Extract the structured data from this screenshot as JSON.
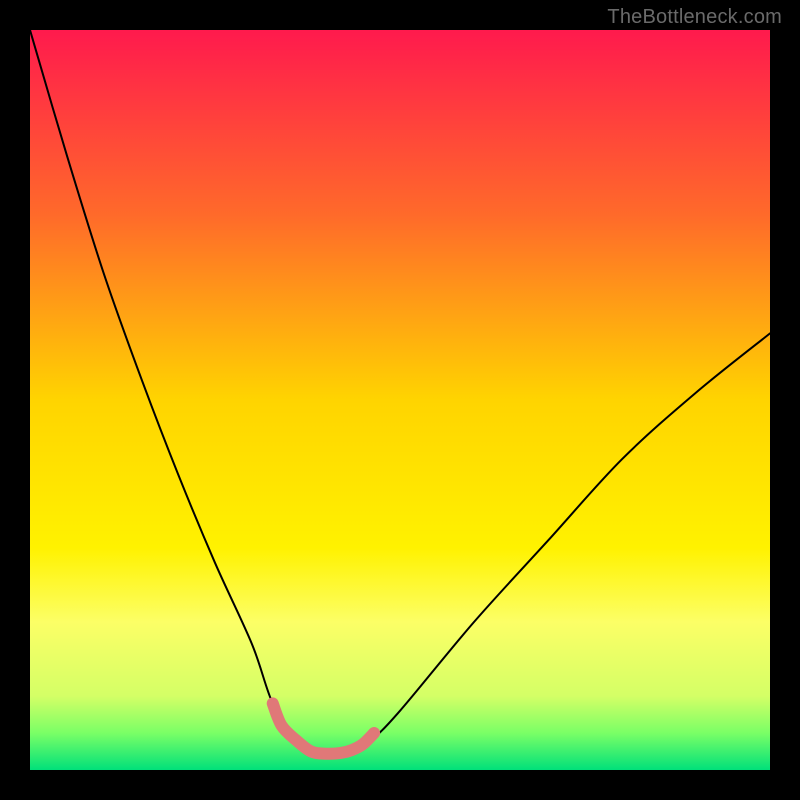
{
  "watermark": "TheBottleneck.com",
  "chart_data": {
    "type": "line",
    "title": "",
    "xlabel": "",
    "ylabel": "",
    "xlim": [
      0,
      100
    ],
    "ylim": [
      0,
      100
    ],
    "background_gradient": {
      "stops": [
        {
          "pos": 0.0,
          "color": "#ff1a4d"
        },
        {
          "pos": 0.25,
          "color": "#ff6a2a"
        },
        {
          "pos": 0.5,
          "color": "#ffd400"
        },
        {
          "pos": 0.7,
          "color": "#fff200"
        },
        {
          "pos": 0.8,
          "color": "#fcff66"
        },
        {
          "pos": 0.9,
          "color": "#d4ff66"
        },
        {
          "pos": 0.95,
          "color": "#7aff66"
        },
        {
          "pos": 1.0,
          "color": "#00e07a"
        }
      ]
    },
    "series": [
      {
        "name": "curve",
        "color": "#000000",
        "stroke_width": 2,
        "x": [
          0,
          5,
          10,
          15,
          20,
          25,
          30,
          32.8,
          36,
          38,
          41,
          43,
          46,
          50,
          60,
          70,
          80,
          90,
          100
        ],
        "values": [
          100,
          83,
          67,
          53,
          40,
          28,
          17,
          9,
          4,
          2.5,
          2.2,
          2.5,
          4,
          8,
          20,
          31,
          42,
          51,
          59
        ]
      },
      {
        "name": "bottleneck-highlight",
        "color": "#e07878",
        "stroke_width": 12,
        "x": [
          32.8,
          34,
          36,
          38,
          40,
          42,
          43.5,
          45,
          46.5
        ],
        "values": [
          9,
          6,
          4,
          2.5,
          2.2,
          2.3,
          2.7,
          3.5,
          5
        ]
      }
    ]
  }
}
